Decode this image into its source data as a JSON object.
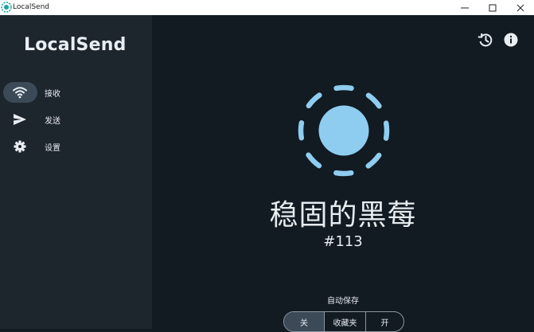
{
  "window": {
    "title": "LocalSend",
    "controls": [
      "minimize-icon",
      "maximize-icon",
      "close-icon"
    ]
  },
  "sidebar": {
    "app_name": "LocalSend",
    "items": [
      {
        "label": "接收",
        "icon": "wifi-icon",
        "active": true
      },
      {
        "label": "发送",
        "icon": "send-icon",
        "active": false
      },
      {
        "label": "设置",
        "icon": "gear-icon",
        "active": false
      }
    ]
  },
  "main": {
    "toolbar_icons": [
      "history-icon",
      "info-icon"
    ],
    "device_name": "稳固的黑莓",
    "device_id": "#113",
    "autosave": {
      "label": "自动保存",
      "options": [
        "关",
        "收藏夹",
        "开"
      ],
      "selected": "关"
    }
  },
  "colors": {
    "sidebar_bg": "#1d252d",
    "main_bg": "#121a22",
    "accent": "#8fcdf0",
    "selected_bg": "#3c4a58"
  }
}
